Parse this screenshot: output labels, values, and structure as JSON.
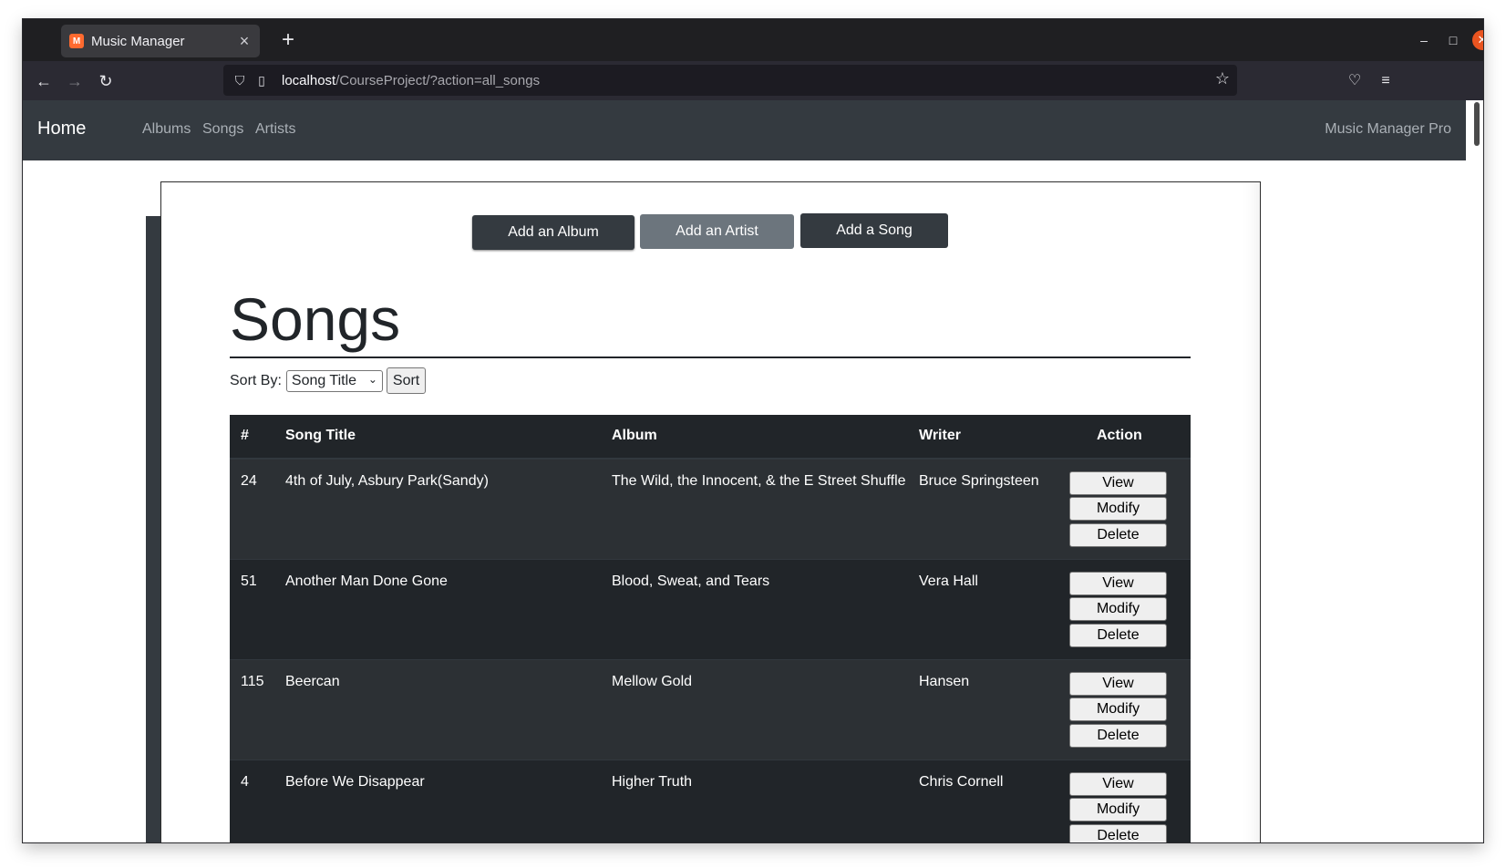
{
  "browser": {
    "tab_title": "Music Manager",
    "favicon_text": "M",
    "new_tab": "+",
    "url_host": "localhost",
    "url_path": "/CourseProject/?action=all_songs"
  },
  "nav": {
    "brand": "Home",
    "links": [
      "Albums",
      "Songs",
      "Artists"
    ],
    "right": "Music Manager Pro"
  },
  "actions": {
    "add_album": "Add an Album",
    "add_artist": "Add an Artist",
    "add_song": "Add a Song"
  },
  "page_title": "Songs",
  "sort": {
    "label": "Sort By:",
    "selected": "Song Title",
    "button": "Sort"
  },
  "table": {
    "headers": [
      "#",
      "Song Title",
      "Album",
      "Writer",
      "Action"
    ],
    "row_buttons": [
      "View",
      "Modify",
      "Delete"
    ],
    "rows": [
      {
        "num": "24",
        "title": "4th of July, Asbury Park(Sandy)",
        "album": "The Wild, the Innocent, & the E Street Shuffle",
        "writer": "Bruce Springsteen"
      },
      {
        "num": "51",
        "title": "Another Man Done Gone",
        "album": "Blood, Sweat, and Tears",
        "writer": "Vera Hall"
      },
      {
        "num": "115",
        "title": "Beercan",
        "album": "Mellow Gold",
        "writer": "Hansen"
      },
      {
        "num": "4",
        "title": "Before We Disappear",
        "album": "Higher Truth",
        "writer": "Chris Cornell"
      }
    ]
  },
  "colors": {
    "navbar": "#343a40",
    "table_bg": "#212529",
    "secondary_button": "#6c757d"
  }
}
